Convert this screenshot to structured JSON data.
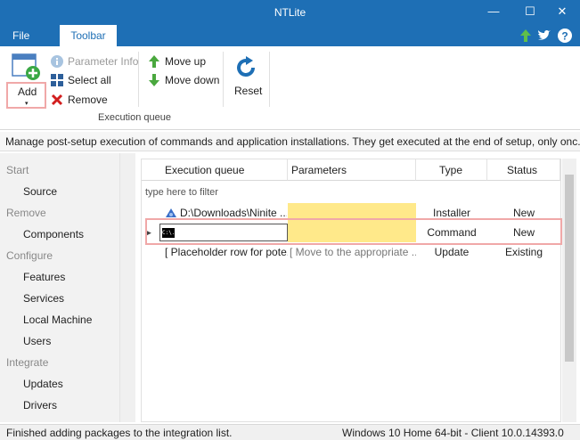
{
  "window": {
    "title": "NTLite",
    "minimize_glyph": "—",
    "maximize_glyph": "☐",
    "close_glyph": "✕"
  },
  "tabs": {
    "file": "File",
    "toolbar": "Toolbar"
  },
  "ribbon": {
    "add": "Add",
    "add_caret": "▾",
    "parameter_info": "Parameter Info",
    "select_all": "Select all",
    "remove": "Remove",
    "move_up": "Move up",
    "move_down": "Move down",
    "reset": "Reset",
    "group_label": "Execution queue"
  },
  "description": "Manage post-setup execution of commands and application installations. They get executed at the end of setup, only onc...",
  "sidebar": {
    "sections": [
      {
        "heading": "Start",
        "items": [
          "Source"
        ]
      },
      {
        "heading": "Remove",
        "items": [
          "Components"
        ]
      },
      {
        "heading": "Configure",
        "items": [
          "Features",
          "Services",
          "Local Machine",
          "Users"
        ]
      },
      {
        "heading": "Integrate",
        "items": [
          "Updates",
          "Drivers"
        ]
      }
    ]
  },
  "grid": {
    "columns": [
      "Execution queue",
      "Parameters",
      "Type",
      "Status"
    ],
    "filter_placeholder": "type here to filter",
    "rows": [
      {
        "queue": "D:\\Downloads\\Ninite ...",
        "parameters": "",
        "type": "Installer",
        "status": "New"
      },
      {
        "queue": "",
        "parameters": "",
        "type": "Command",
        "status": "New",
        "icon_text": "C:\\."
      },
      {
        "queue": "[ Placeholder row for pote...",
        "parameters": "[ Move to the appropriate ...",
        "type": "Update",
        "status": "Existing"
      }
    ]
  },
  "status": {
    "left": "Finished adding packages to the integration list.",
    "right": "Windows 10 Home 64-bit - Client 10.0.14393.0"
  },
  "colors": {
    "accent": "#1e6fb5",
    "highlight": "#f0a8a8",
    "param_fill": "#ffe98a"
  }
}
